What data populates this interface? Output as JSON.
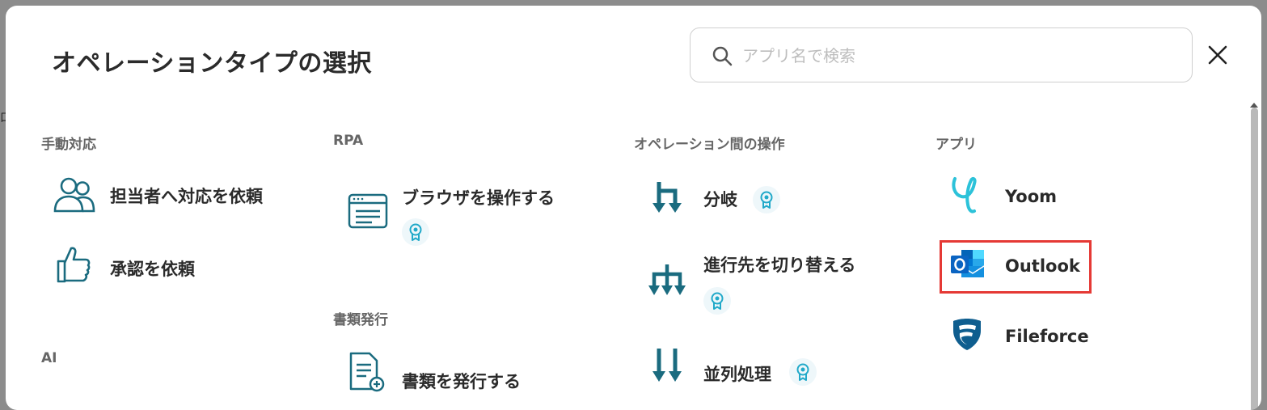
{
  "modal": {
    "title": "オペレーションタイプの選択",
    "search": {
      "placeholder": "アプリ名で検索",
      "value": ""
    }
  },
  "columns": {
    "manual": {
      "heading": "手動対応",
      "items": [
        {
          "label": "担当者へ対応を依頼"
        },
        {
          "label": "承認を依頼"
        }
      ]
    },
    "ai": {
      "heading": "AI"
    },
    "rpa": {
      "heading": "RPA",
      "items": [
        {
          "label": "ブラウザを操作する",
          "badge": true
        }
      ]
    },
    "documents": {
      "heading": "書類発行",
      "items": [
        {
          "label": "書類を発行する"
        }
      ]
    },
    "between_ops": {
      "heading": "オペレーション間の操作",
      "items": [
        {
          "label": "分岐",
          "badge": true
        },
        {
          "label": "進行先を切り替える",
          "badge": true
        },
        {
          "label": "並列処理",
          "badge": true
        }
      ]
    },
    "apps": {
      "heading": "アプリ",
      "items": [
        {
          "label": "Yoom"
        },
        {
          "label": "Outlook",
          "highlighted": true
        },
        {
          "label": "Fileforce"
        }
      ]
    }
  },
  "colors": {
    "icon_teal": "#1a6b7f",
    "badge_blue": "#21a9c9",
    "highlight_red": "#e53935",
    "outlook_blue": "#0a64c2",
    "yoom_cyan": "#2cc2d9"
  }
}
